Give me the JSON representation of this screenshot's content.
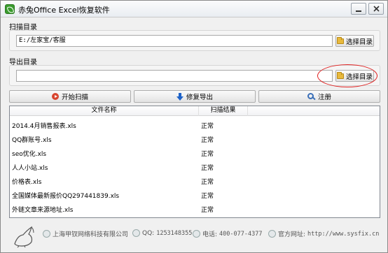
{
  "window": {
    "title": "赤兔Office Excel恢复软件"
  },
  "scan_dir": {
    "label": "扫描目录",
    "value": "E:/左家宝/客服",
    "button_label": "选择目录"
  },
  "export_dir": {
    "label": "导出目录",
    "value": "",
    "button_label": "选择目录"
  },
  "actions": {
    "start_scan": "开始扫描",
    "repair_export": "修复导出",
    "register": "注册"
  },
  "table": {
    "headers": {
      "name": "文件名称",
      "result": "扫描结果"
    },
    "rows": [
      {
        "name": "2014.4月销售报表.xls",
        "result": "正常"
      },
      {
        "name": "QQ群账号.xls",
        "result": "正常"
      },
      {
        "name": "seo优化.xls",
        "result": "正常"
      },
      {
        "name": "人人小站.xls",
        "result": "正常"
      },
      {
        "name": "价格表.xls",
        "result": "正常"
      },
      {
        "name": "全国媒体最新报价QQ297441839.xls",
        "result": "正常"
      },
      {
        "name": "外链文章来源地址.xls",
        "result": "正常"
      }
    ]
  },
  "footer": {
    "company": "上海甲钗网络科技有限公司",
    "qq_label": "QQ:",
    "qq_value": "1253148355",
    "phone_label": "电话:",
    "phone_value": "400-077-4377",
    "site_label": "官方网址:",
    "site_value": "http://www.sysfix.cn"
  }
}
